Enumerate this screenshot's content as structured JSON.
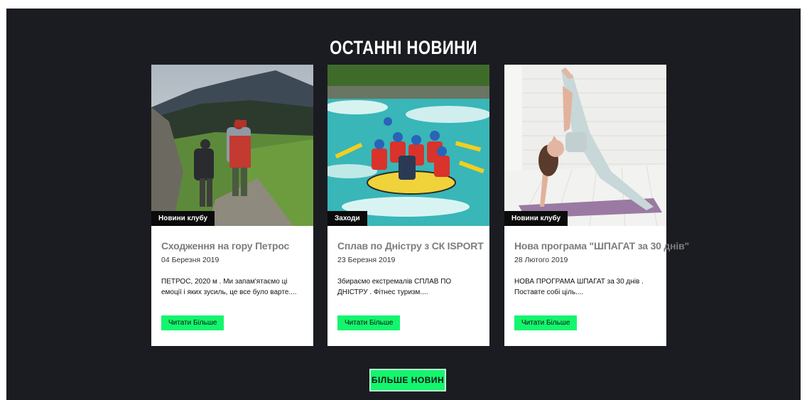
{
  "section": {
    "title": "ОСТАННІ НОВИНИ"
  },
  "colors": {
    "background": "#1b1c21",
    "accent": "#14f56e",
    "card": "#ffffff"
  },
  "news": [
    {
      "category": "Новини клубу",
      "title": "Сходження на гору Петрос",
      "date": "04 Березня 2019",
      "excerpt": "ПЕТРОС, 2020 м . Ми запам'ятаємо ці емоції і яких зусиль, це все було варте....",
      "button": "Читати Більше",
      "image": "hikers-mountain-photo"
    },
    {
      "category": "Заходи",
      "title": "Сплав по Дністру з СК ISPORT",
      "date": "23 Березня 2019",
      "excerpt": "Збираємо екстремалів СПЛАВ ПО ДНІСТРУ . Фітнес туризм....",
      "button": "Читати Більше",
      "image": "rafting-river-photo"
    },
    {
      "category": "Новини клубу",
      "title": "Нова програма \"ШПАГАТ за 30 днів\"",
      "date": "28 Лютого 2019",
      "excerpt": "НОВА ПРОГРАМА ШПАГАТ за 30 днів . Поставте собі ціль....",
      "button": "Читати Більше",
      "image": "yoga-split-photo"
    }
  ],
  "more_button": "БІЛЬШЕ НОВИН"
}
